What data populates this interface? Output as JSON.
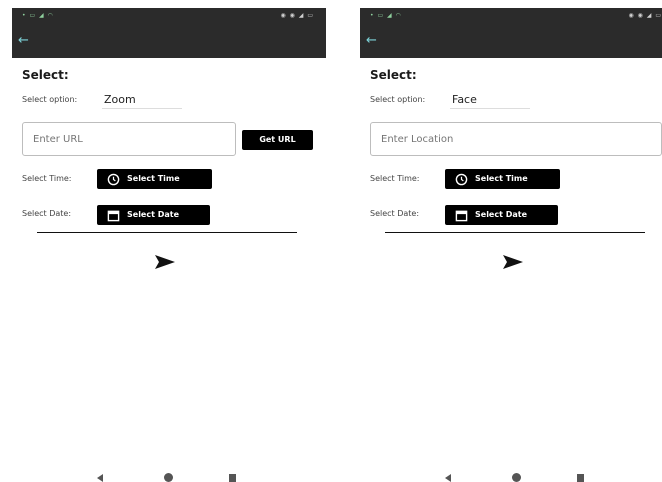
{
  "status_bar": {
    "left_text": "• ▭ ◢ ◠",
    "right_text": "◉ ◉ ◢ ▭"
  },
  "screens": [
    {
      "heading": "Select:",
      "option_label": "Select option:",
      "option_value": "Zoom",
      "text_field_placeholder": "Enter URL",
      "get_url_label": "Get URL",
      "time_label": "Select Time:",
      "time_button_label": "Select Time",
      "date_label": "Select Date:",
      "date_button_label": "Select Date"
    },
    {
      "heading": "Select:",
      "option_label": "Select option:",
      "option_value": "Face",
      "text_field_placeholder": "Enter Location",
      "time_label": "Select Time:",
      "time_button_label": "Select Time",
      "date_label": "Select Date:",
      "date_button_label": "Select Date"
    }
  ],
  "icons": {
    "back": "arrow-left-icon",
    "clock": "clock-icon",
    "calendar": "calendar-icon",
    "send": "send-icon"
  },
  "colors": {
    "appbar": "#2b2b2b",
    "button": "#000000",
    "back_arrow": "#7dd3d8"
  }
}
